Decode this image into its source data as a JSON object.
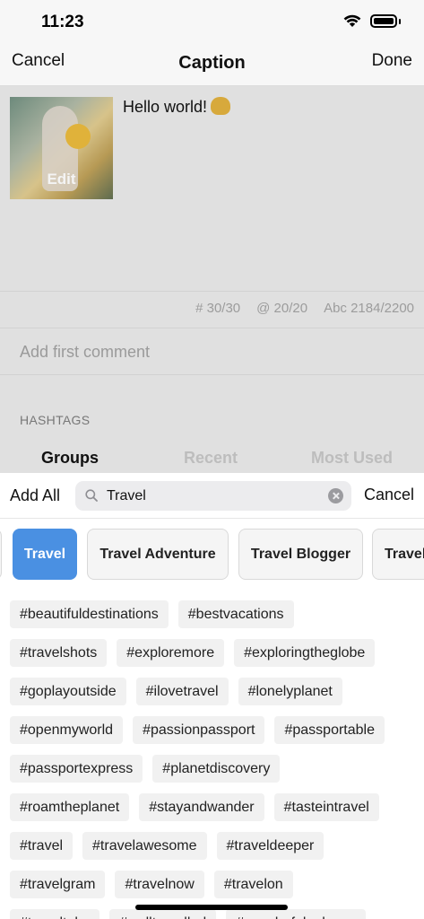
{
  "status_bar": {
    "time": "11:23"
  },
  "nav": {
    "cancel": "Cancel",
    "title": "Caption",
    "done": "Done"
  },
  "editor": {
    "edit_label": "Edit",
    "caption": "Hello world!",
    "counters": {
      "hashtags": "# 30/30",
      "mentions": "@ 20/20",
      "chars": "Abc 2184/2200"
    },
    "first_comment_placeholder": "Add first comment",
    "hashtags_label": "HASHTAGS",
    "tabs": [
      "Groups",
      "Recent",
      "Most Used"
    ]
  },
  "sheet": {
    "add_all": "Add All",
    "search_value": "Travel",
    "cancel": "Cancel",
    "chips": [
      "Travel",
      "Travel Adventure",
      "Travel Blogger",
      "Travel"
    ],
    "selected_chip": "Travel",
    "accent_color": "#4a90e2",
    "tag_rows": [
      [
        "#beautifuldestinations",
        "#bestvacations"
      ],
      [
        "#travelshots",
        "#exploremore",
        "#exploringtheglobe"
      ],
      [
        "#goplayoutside",
        "#ilovetravel",
        "#lonelyplanet"
      ],
      [
        "#openmyworld",
        "#passionpassport",
        "#passportable"
      ],
      [
        "#passportexpress",
        "#planetdiscovery"
      ],
      [
        "#roamtheplanet",
        "#stayandwander",
        "#tasteintravel"
      ],
      [
        "#travel",
        "#travelawesome",
        "#traveldeeper"
      ],
      [
        "#travelgram",
        "#travelnow",
        "#travelon"
      ],
      [
        "#traveltoke",
        "#welltravelled",
        "#wonderful_places"
      ]
    ]
  }
}
